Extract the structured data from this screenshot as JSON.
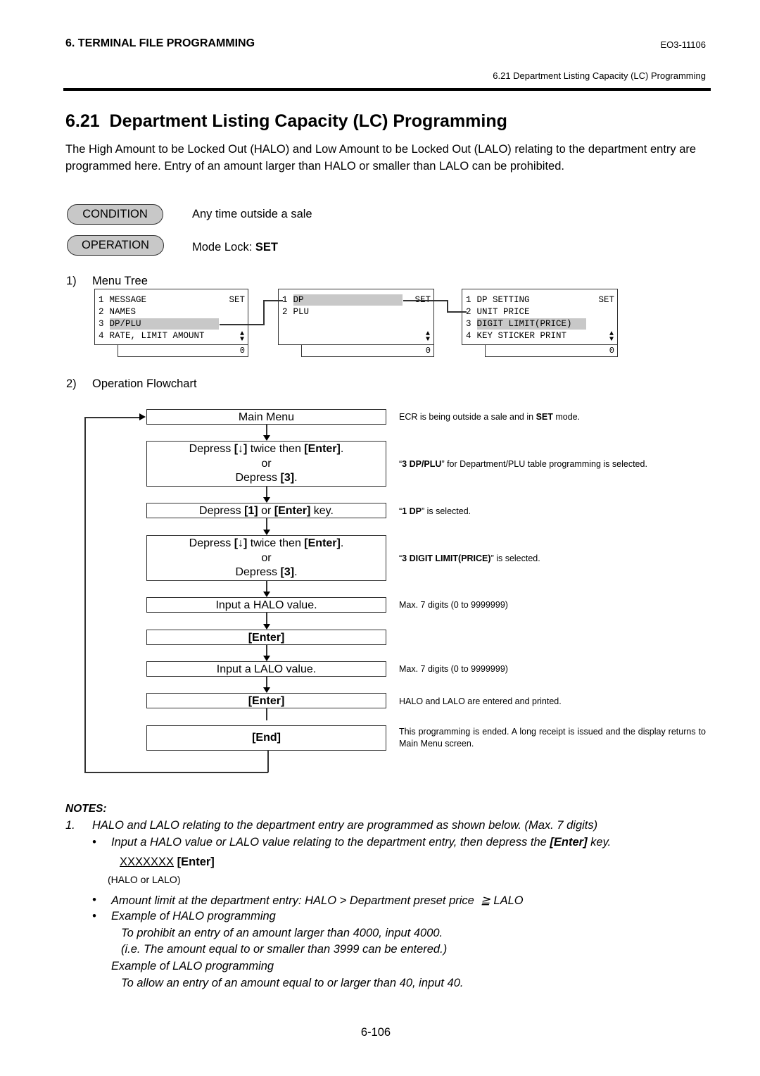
{
  "header": {
    "chapter": "6. TERMINAL FILE PROGRAMMING",
    "doc_code": "EO3-11106",
    "section_ref": "6.21 Department Listing Capacity (LC) Programming"
  },
  "title": "6.21  Department Listing Capacity (LC) Programming",
  "intro": "The High Amount to be Locked Out (HALO) and Low Amount to be Locked Out (LALO) relating to the department entry are programmed here.  Entry of an amount larger than HALO or smaller than LALO can be prohibited.",
  "condition": {
    "label": "CONDITION",
    "text": "Any time outside a sale"
  },
  "operation": {
    "label": "OPERATION",
    "text_prefix": "Mode Lock: ",
    "text_bold": "SET"
  },
  "menu_tree": {
    "num": "1)",
    "heading": "Menu Tree",
    "screens": [
      {
        "rows": [
          {
            "num": "1",
            "label": "MESSAGE",
            "right": "SET",
            "highlight": false
          },
          {
            "num": "2",
            "label": "NAMES",
            "right": "",
            "highlight": false
          },
          {
            "num": "3",
            "label": "DP/PLU",
            "right": "",
            "highlight": true
          },
          {
            "num": "4",
            "label": "RATE, LIMIT AMOUNT",
            "right": "",
            "highlight": false
          }
        ],
        "footer": "0"
      },
      {
        "rows": [
          {
            "num": "1",
            "label": "DP",
            "right": "SET",
            "highlight": true
          },
          {
            "num": "2",
            "label": "PLU",
            "right": "",
            "highlight": false
          }
        ],
        "footer": "0"
      },
      {
        "rows": [
          {
            "num": "1",
            "label": "DP SETTING",
            "right": "SET",
            "highlight": false
          },
          {
            "num": "2",
            "label": "UNIT PRICE",
            "right": "",
            "highlight": false
          },
          {
            "num": "3",
            "label": "DIGIT LIMIT(PRICE)",
            "right": "",
            "highlight": true
          },
          {
            "num": "4",
            "label": "KEY STICKER PRINT",
            "right": "",
            "highlight": false
          }
        ],
        "footer": "0"
      }
    ]
  },
  "flowchart": {
    "num": "2)",
    "heading": "Operation Flowchart",
    "steps": [
      {
        "lines": [
          "Main Menu"
        ],
        "note": "ECR is being outside a sale and in SET mode."
      },
      {
        "lines": [
          "Depress [↓] twice then [Enter].",
          "or",
          "Depress [3]."
        ],
        "note": "“3 DP/PLU” for Department/PLU table programming is selected."
      },
      {
        "lines": [
          "Depress [1] or [Enter] key."
        ],
        "note": "“1 DP” is selected."
      },
      {
        "lines": [
          "Depress [↓] twice then [Enter].",
          "or",
          "Depress [3]."
        ],
        "note": "“3 DIGIT LIMIT(PRICE)” is selected."
      },
      {
        "lines": [
          "Input a HALO value."
        ],
        "note": "Max. 7 digits (0 to 9999999)"
      },
      {
        "lines": [
          "[Enter]"
        ],
        "note": ""
      },
      {
        "lines": [
          "Input a LALO value."
        ],
        "note": "Max. 7 digits (0 to 9999999)"
      },
      {
        "lines": [
          "[Enter]"
        ],
        "note": "HALO and LALO are entered and printed."
      },
      {
        "lines": [
          "[End]"
        ],
        "note": "This programming is ended.  A long receipt is issued and the display returns to Main Menu screen."
      }
    ]
  },
  "notes": {
    "heading": "NOTES:",
    "item1_num": "1.",
    "item1": "HALO and LALO relating to the department entry are programmed as shown below. (Max. 7 digits)",
    "bullet1_prefix": "Input a HALO value or LALO value relating to the department entry, then depress the ",
    "bullet1_key": "[Enter]",
    "bullet1_suffix": " key.",
    "entry_value": "XXXXXXX",
    "entry_key": "[Enter]",
    "entry_caption": "(HALO or LALO)",
    "bullet2": "Amount limit at the department entry: HALO > Department preset price  ≧ LALO",
    "bullet3": "Example of HALO programming",
    "halo_ex1": "To prohibit an entry of an amount larger than 4000, input 4000.",
    "halo_ex2": "(i.e. The amount equal to or smaller than 3999 can be entered.)",
    "lalo_heading": "Example of LALO programming",
    "lalo_ex": "To allow an entry of an amount equal to or larger than 40, input 40."
  },
  "page_number": "6-106"
}
